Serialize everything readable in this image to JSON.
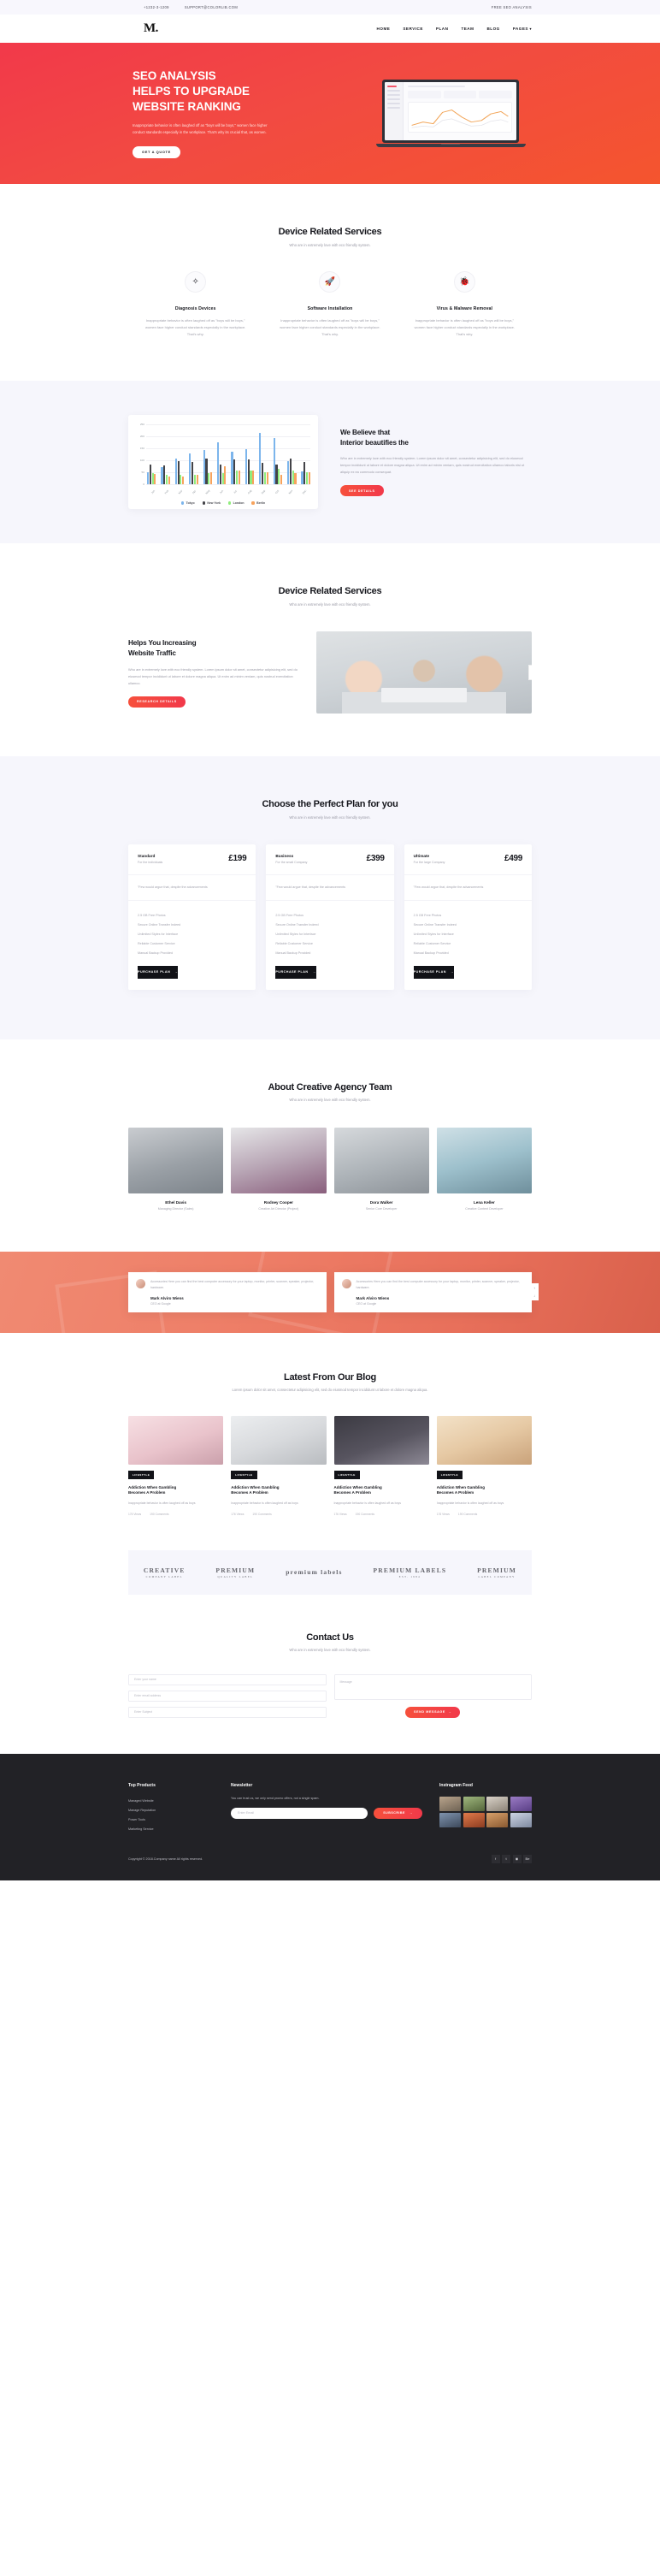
{
  "topbar": {
    "phone": "+1232-3-1209",
    "email": "SUPPORT@COLORLIB.COM",
    "right": "FREE SEO ANALYSIS"
  },
  "nav": {
    "logo": "M.",
    "items": [
      {
        "label": "HOME"
      },
      {
        "label": "SERVICE"
      },
      {
        "label": "PLAN"
      },
      {
        "label": "TEAM"
      },
      {
        "label": "BLOG"
      },
      {
        "label": "PAGES"
      }
    ],
    "caret": "▾"
  },
  "hero": {
    "line1": "SEO ANALYSIS",
    "line2": "HELPS TO UPGRADE",
    "line3": "WEBSITE RANKING",
    "paragraph": "Inappropriate behavior is often laughed off as \"boys will be boys,\" women face higher conduct standards especially in the workplace. That's why its crucial that, as women.",
    "cta": "GET A QUOTE"
  },
  "services": {
    "title": "Device Related Services",
    "subtitle": "Who are in extremely love with eco friendly system.",
    "items": [
      {
        "icon": "magic-wand-icon",
        "glyph": "✧",
        "title": "Diagnosis Devices",
        "text": "Inappropriate behavior is often laughed off as \"boys will be boys,\" women face higher conduct standards especially in the workplace. That's why."
      },
      {
        "icon": "rocket-icon",
        "glyph": "🚀",
        "title": "Software Installation",
        "text": "Inappropriate behavior is often laughed off as \"boys will be boys,\" women face higher conduct standards especially in the workplace. That's why."
      },
      {
        "icon": "bug-icon",
        "glyph": "🐞",
        "title": "Virus & Malware Removal",
        "text": "Inappropriate behavior is often laughed off as \"boys will be boys,\" women face higher conduct standards especially in the workplace. That's why."
      }
    ]
  },
  "chart_data": {
    "type": "bar",
    "title": "",
    "xlabel": "",
    "ylabel": "",
    "ylim": [
      0,
      250
    ],
    "yticks": [
      0,
      50,
      100,
      150,
      200,
      250
    ],
    "grid": true,
    "legend_position": "bottom",
    "categories": [
      "Jan",
      "Feb",
      "Mar",
      "Apr",
      "May",
      "Jun",
      "Jul",
      "Aug",
      "Sep",
      "Oct",
      "Nov",
      "Dec"
    ],
    "series": [
      {
        "name": "Tokyo",
        "color": "#7cb5ec",
        "values": [
          49,
          71,
          106,
          129,
          144,
          176,
          135,
          148,
          216,
          194,
          95,
          54
        ]
      },
      {
        "name": "New York",
        "color": "#434348",
        "values": [
          83,
          78,
          98,
          93,
          106,
          84,
          105,
          104,
          91,
          83,
          106,
          92
        ]
      },
      {
        "name": "London",
        "color": "#90ed7d",
        "values": [
          48,
          38,
          39,
          41,
          47,
          48,
          59,
          59,
          52,
          65,
          59,
          51
        ]
      },
      {
        "name": "Berlin",
        "color": "#f7a35c",
        "values": [
          42,
          33,
          34,
          39,
          52,
          75,
          57,
          59,
          52,
          38,
          46,
          51
        ]
      }
    ]
  },
  "believe": {
    "heading_l1": "We Believe that",
    "heading_l2": "Interior beautifies the",
    "paragraph": "Who are in extremely love with eco friendly system. Lorem ipsum dolor sit amet, consectetur adipisicing elit, sed do eiusmod tempor incididunt ut labore et dolore magna aliqua. Ut enim ad minim veniam, quis nostrud exercitation ullamco laboris nisi ut aliquip ex ea commodo consequat.",
    "cta": "SEE DETAILS"
  },
  "traffic": {
    "title": "Device Related Services",
    "subtitle": "Who are in extremely love with eco friendly system.",
    "heading_l1": "Helps You Increasing",
    "heading_l2": "Website Traffic",
    "paragraph": "Who are in extremely love with eco friendly system. Lorem ipsum dolor sit amet, consectetur adipisicing elit, sed do eiusmod tempor incididunt ut labore et dolore magna aliqua. Ut enim ad minim veniam, quis nostrud exercitation ullamco.",
    "cta": "RESEARCH DETAILS",
    "arrow": "›"
  },
  "pricing": {
    "title": "Choose the Perfect Plan for you",
    "subtitle": "Who are in extremely love with eco friendly system.",
    "plans": [
      {
        "name": "Standard",
        "for": "For the individuals",
        "price": "£199",
        "desc": "\"Few would argue that, despite the advancements",
        "features": [
          "2.5 GB Free Photos",
          "Secure Online Transfer Indeed",
          "Unlimited Styles for Interface",
          "Reliable Customer Service",
          "Manual Backup Provided"
        ],
        "cta": "PURCHASE PLAN"
      },
      {
        "name": "Business",
        "for": "For the small Company",
        "price": "£399",
        "desc": "\"Few would argue that, despite the advancements",
        "features": [
          "2.5 GB Free Photos",
          "Secure Online Transfer Indeed",
          "Unlimited Styles for Interface",
          "Reliable Customer Service",
          "Manual Backup Provided"
        ],
        "cta": "PURCHASE PLAN"
      },
      {
        "name": "Ultimate",
        "for": "For the large Company",
        "price": "£499",
        "desc": "\"Few would argue that, despite the advancements",
        "features": [
          "2.5 GB Free Photos",
          "Secure Online Transfer Indeed",
          "Unlimited Styles for Interface",
          "Reliable Customer Service",
          "Manual Backup Provided"
        ],
        "cta": "PURCHASE PLAN"
      }
    ],
    "cta_arrow": "→"
  },
  "team": {
    "title": "About Creative Agency Team",
    "subtitle": "Who are in extremely love with eco friendly system.",
    "members": [
      {
        "name": "Ethel Davis",
        "role": "Managing Director (Sales)"
      },
      {
        "name": "Rodney Cooper",
        "role": "Creative Art Director (Project)"
      },
      {
        "name": "Dora Walker",
        "role": "Senior Core Developer"
      },
      {
        "name": "Lena Keller",
        "role": "Creative Content Developer"
      }
    ]
  },
  "testimonials": {
    "items": [
      {
        "quote": "Accessories Here you can find the best computer accessory for your laptop, monitor, printer, scanner, speaker, projector, hardware.",
        "name": "Mark Alviro Wiens",
        "role": "CEO at Google"
      },
      {
        "quote": "Accessories Here you can find the best computer accessory for your laptop, monitor, printer, scanner, speaker, projector, hardware.",
        "name": "Mark Alviro Wiens",
        "role": "CEO at Google"
      }
    ],
    "nav_up": "↑",
    "nav_down": "↓"
  },
  "blog": {
    "title": "Latest From Our Blog",
    "subtitle": "Lorem ipsum dolor sit amet, consectetur adipisicing elit, sed do eiusmod tempor incididunt ut labore et dolore magna aliqua.",
    "posts": [
      {
        "tag": "LIFESTYLE",
        "title_l1": "Addiction When Gambling",
        "title_l2": "Becomes A Problem",
        "text": "Inappropriate behavior is often laughed off as boys",
        "views": "176 Views",
        "comments": "190 Comments"
      },
      {
        "tag": "LIFESTYLE",
        "title_l1": "Addiction When Gambling",
        "title_l2": "Becomes A Problem",
        "text": "Inappropriate behavior is often laughed off as boys",
        "views": "176 Views",
        "comments": "190 Comments"
      },
      {
        "tag": "LIFESTYLE",
        "title_l1": "Addiction When Gambling",
        "title_l2": "Becomes A Problem",
        "text": "Inappropriate behavior is often laughed off as boys",
        "views": "176 Views",
        "comments": "190 Comments"
      },
      {
        "tag": "LIFESTYLE",
        "title_l1": "Addiction When Gambling",
        "title_l2": "Becomes A Problem",
        "text": "Inappropriate behavior is often laughed off as boys",
        "views": "176 Views",
        "comments": "190 Comments"
      }
    ]
  },
  "brands": [
    {
      "line1": "CREATIVE",
      "line2": "COMPANY LABEL"
    },
    {
      "line1": "PREMIUM",
      "line2": "QUALITY LABEL"
    },
    {
      "line1": "premium labels",
      "line2": ""
    },
    {
      "line1": "PREMIUM LABELS",
      "line2": "EST. 1984"
    },
    {
      "line1": "PREMIUM",
      "line2": "LABEL COMPANY"
    }
  ],
  "contact": {
    "title": "Contact Us",
    "subtitle": "Who are in extremely love with eco friendly system.",
    "name_placeholder": "Enter your name",
    "email_placeholder": "Enter email address",
    "subject_placeholder": "Enter Subject",
    "message_placeholder": "Message",
    "cta": "SEND MESSAGE",
    "cta_arrow": "→"
  },
  "footer": {
    "products_title": "Top Products",
    "products": [
      "Managed Website",
      "Manage Reputation",
      "Power Tools",
      "Marketing Service"
    ],
    "newsletter_title": "Newsletter",
    "newsletter_text": "You can trust us, we only send promo offers, not a single spam.",
    "email_placeholder": "Enter Email",
    "subscribe": "SUBSCRIBE",
    "subscribe_arrow": "→",
    "instagram_title": "Instragram Feed",
    "copyright": "Copyright © 2018.Company name All rights reserved.",
    "socials": [
      {
        "name": "facebook-icon",
        "glyph": "f"
      },
      {
        "name": "twitter-icon",
        "glyph": "t"
      },
      {
        "name": "dribbble-icon",
        "glyph": "◉"
      },
      {
        "name": "behance-icon",
        "glyph": "Be"
      }
    ]
  }
}
